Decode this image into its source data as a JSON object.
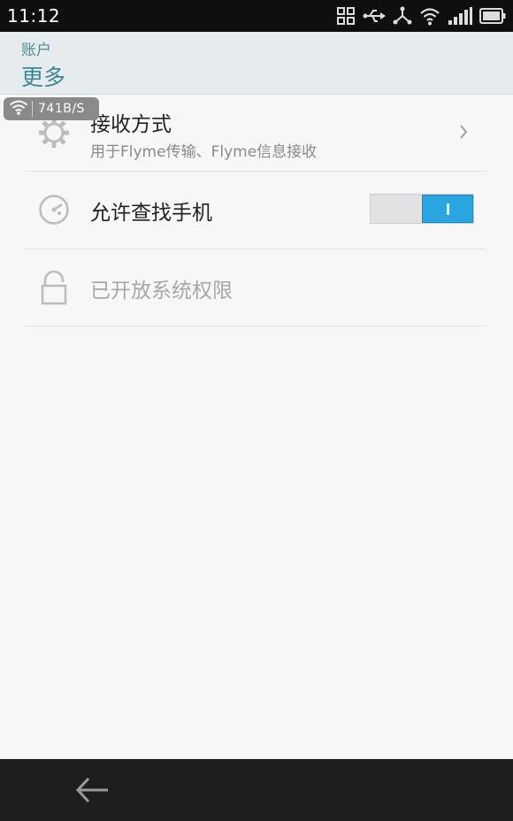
{
  "status_bar": {
    "time": "11:12",
    "icons": [
      "screenshot-icon",
      "usb-icon",
      "share-icon",
      "wifi-icon",
      "signal-icon",
      "battery-icon"
    ]
  },
  "header": {
    "parent": "账户",
    "title": "更多"
  },
  "speed_overlay": {
    "speed": "741B/S",
    "icon": "wifi-icon"
  },
  "settings": {
    "receive": {
      "title": "接收方式",
      "subtitle": "用于Flyme传输、Flyme信息接收",
      "icon": "gear-icon"
    },
    "find_phone": {
      "title": "允许查找手机",
      "icon": "radar-icon",
      "enabled": true
    },
    "permissions": {
      "title": "已开放系统权限",
      "icon": "lock-icon"
    }
  },
  "colors": {
    "accent": "#3f8594",
    "toggle_on": "#29a6e0",
    "status_bar": "#0f0f0f",
    "nav_bar": "#1e1e1e"
  }
}
